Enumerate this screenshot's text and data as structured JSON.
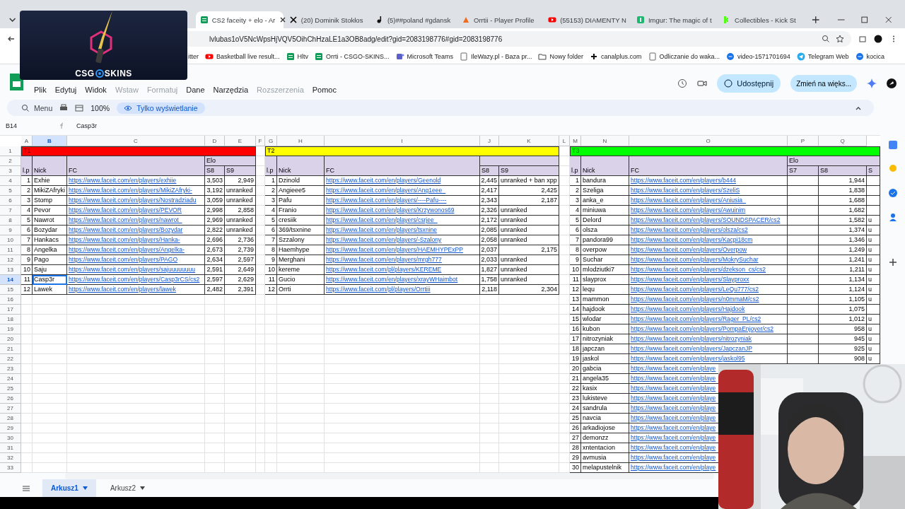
{
  "overlay": {
    "brand_left": "CSG",
    "brand_right": "SKINS"
  },
  "browser": {
    "tabs": [
      {
        "title": "CS2 faceity + elo - Ar",
        "kind": "sheets",
        "selected": true
      },
      {
        "title": "(20) Dominik Stokłos",
        "kind": "x",
        "selected": false
      },
      {
        "title": "(5)##poland #gdansk",
        "kind": "tiktok",
        "selected": false
      },
      {
        "title": "Orrtii - Player Profile",
        "kind": "orange",
        "selected": false
      },
      {
        "title": "(55153) DIAMENTY N",
        "kind": "youtube",
        "selected": false
      },
      {
        "title": "Imgur: The magic of t",
        "kind": "imgur",
        "selected": false
      },
      {
        "title": "Collectibles - Kick St",
        "kind": "kick",
        "selected": false
      }
    ],
    "url": "lvlubas1oV5NcWpsHjVQV5OihChHzaLE1a3OB8adg/edit?gid=2083198776#gid=2083198776",
    "bookmarks": [
      {
        "label": "itter",
        "kind": "none"
      },
      {
        "label": "Basketball live result...",
        "kind": "youtube"
      },
      {
        "label": "Hltv",
        "kind": "sheets"
      },
      {
        "label": "Orrti - CSGO-SKINS...",
        "kind": "sheets"
      },
      {
        "label": "Microsoft Teams",
        "kind": "teams"
      },
      {
        "label": "IleWazy.pl - Baza pr...",
        "kind": "page"
      },
      {
        "label": "Nowy folder",
        "kind": "folder"
      },
      {
        "label": "canalplus.com",
        "kind": "plus"
      },
      {
        "label": "Odliczanie do waka...",
        "kind": "page"
      },
      {
        "label": "video-1571701694",
        "kind": "link"
      },
      {
        "label": "Telegram Web",
        "kind": "telegram"
      },
      {
        "label": "kocica",
        "kind": "link"
      }
    ]
  },
  "sheets": {
    "menu": [
      {
        "label": "Plik",
        "disabled": false
      },
      {
        "label": "Edytuj",
        "disabled": false
      },
      {
        "label": "Widok",
        "disabled": false
      },
      {
        "label": "Wstaw",
        "disabled": true
      },
      {
        "label": "Formatuj",
        "disabled": true
      },
      {
        "label": "Dane",
        "disabled": false
      },
      {
        "label": "Narzędzia",
        "disabled": false
      },
      {
        "label": "Rozszerzenia",
        "disabled": true
      },
      {
        "label": "Pomoc",
        "disabled": false
      }
    ],
    "share_button": "Udostępnij",
    "upgrade_button": "Zmień na więks...",
    "search_placeholder": "Menu",
    "zoom": "100%",
    "view_mode": "Tylko wyświetlanie",
    "name_box": "B14",
    "formula": "Casp3r",
    "columns": [
      "A",
      "B",
      "C",
      "D",
      "E",
      "F",
      "G",
      "H",
      "I",
      "J",
      "K",
      "L",
      "M",
      "N",
      "O",
      "P",
      "Q"
    ],
    "row_numbers": [
      "1",
      "2",
      "3",
      "4",
      "5",
      "6",
      "7",
      "8",
      "9",
      "10",
      "11",
      "12",
      "13",
      "14",
      "15",
      "16",
      "17",
      "18",
      "19",
      "20",
      "21",
      "22",
      "23",
      "24",
      "25",
      "26",
      "27",
      "28",
      "29",
      "30",
      "31",
      "32",
      "33"
    ],
    "sheet_tabs": [
      {
        "label": "Arkusz1",
        "selected": true
      },
      {
        "label": "Arkusz2",
        "selected": false
      }
    ]
  },
  "tables": [
    {
      "title": "T1",
      "color": "#ff0000",
      "headers": {
        "lp": "l.p",
        "nick": "Nick",
        "fc": "FC"
      },
      "elo_label": "Elo",
      "elo_columns": [
        "S8",
        "S9"
      ],
      "rows": [
        {
          "lp": "1",
          "nick": "Exhie",
          "fc": "https://www.faceit.com/en/players/exhiie",
          "elo": [
            "3,503",
            "2,949"
          ],
          "selected": false
        },
        {
          "lp": "2",
          "nick": "MikiZAfryki",
          "fc": "https://www.faceit.com/en/players/MikiZAfryki-",
          "elo": [
            "3,192",
            "unranked"
          ],
          "selected": false
        },
        {
          "lp": "3",
          "nick": "Stomp",
          "fc": "https://www.faceit.com/en/players/Nostradziadu",
          "elo": [
            "3,059",
            "unranked"
          ],
          "selected": false
        },
        {
          "lp": "4",
          "nick": "Pevor",
          "fc": "https://www.faceit.com/en/players/PEVOR",
          "elo": [
            "2,998",
            "2,858"
          ],
          "selected": false
        },
        {
          "lp": "5",
          "nick": "Nawrot",
          "fc": "https://www.faceit.com/en/players/nawrot_",
          "elo": [
            "2,969",
            "unranked"
          ],
          "selected": false
        },
        {
          "lp": "6",
          "nick": "Bozydar",
          "fc": "https://www.faceit.com/en/players/Bozydar",
          "elo": [
            "2,822",
            "unranked"
          ],
          "selected": false
        },
        {
          "lp": "7",
          "nick": "Hankacs",
          "fc": "https://www.faceit.com/en/players/Hanka-",
          "elo": [
            "2,696",
            "2,736"
          ],
          "selected": false
        },
        {
          "lp": "8",
          "nick": "Angelka",
          "fc": "https://www.faceit.com/en/players/Angelka-",
          "elo": [
            "2,673",
            "2,739"
          ],
          "selected": false
        },
        {
          "lp": "9",
          "nick": "Pago",
          "fc": "https://www.faceit.com/en/players/PAGO",
          "elo": [
            "2,634",
            "2,597"
          ],
          "selected": false
        },
        {
          "lp": "10",
          "nick": "Saju",
          "fc": "https://www.faceit.com/en/players/sajuuuuuuuu",
          "elo": [
            "2,591",
            "2,649"
          ],
          "selected": false
        },
        {
          "lp": "11",
          "nick": "Casp3r",
          "fc": "https://www.faceit.com/en/players/Casp3rCS/cs2",
          "elo": [
            "2,597",
            "2,629"
          ],
          "selected": true
        },
        {
          "lp": "12",
          "nick": "Lawek",
          "fc": "https://www.faceit.com/en/players/lawek",
          "elo": [
            "2,482",
            "2,391"
          ],
          "selected": false
        }
      ]
    },
    {
      "title": "T2",
      "color": "#ffff00",
      "headers": {
        "lp": "l.p",
        "nick": "Nick",
        "fc": "FC"
      },
      "elo_columns": [
        "S8",
        "S9"
      ],
      "rows": [
        {
          "lp": "1",
          "nick": "Dzinold",
          "fc": "https://www.faceit.com/en/players/Geenold",
          "elo": [
            "2,445",
            "unranked + ban xpp"
          ],
          "selected": false
        },
        {
          "lp": "2",
          "nick": "Angieee5",
          "fc": "https://www.faceit.com/en/players/Ang1eee_",
          "elo": [
            "2,417",
            "2,425"
          ],
          "selected": false
        },
        {
          "lp": "3",
          "nick": "Pafu",
          "fc": "https://www.faceit.com/en/players/----Pafu----",
          "elo": [
            "2,343",
            "2,187"
          ],
          "selected": false
        },
        {
          "lp": "4",
          "nick": "Franio",
          "fc": "https://www.faceit.com/en/players/Krzywonos69",
          "elo": [
            "2,326",
            "unranked"
          ],
          "selected": false
        },
        {
          "lp": "5",
          "nick": "cresiik",
          "fc": "https://www.faceit.com/en/players/csrjee_",
          "elo": [
            "2,172",
            "unranked"
          ],
          "selected": false
        },
        {
          "lp": "6",
          "nick": "369/tsxnine",
          "fc": "https://www.faceit.com/en/players/tsxnine",
          "elo": [
            "2,085",
            "unranked"
          ],
          "selected": false
        },
        {
          "lp": "7",
          "nick": "Szzalony",
          "fc": "https://www.faceit.com/en/players/-Szalony",
          "elo": [
            "2,058",
            "unranked"
          ],
          "selected": false
        },
        {
          "lp": "8",
          "nick": "Haemhype",
          "fc": "https://www.faceit.com/en/players/HAEMHYPExPP",
          "elo": [
            "2,037",
            "2,175"
          ],
          "selected": false
        },
        {
          "lp": "9",
          "nick": "Merghani",
          "fc": "https://www.faceit.com/en/players/mrgh777",
          "elo": [
            "2,033",
            "unranked"
          ],
          "selected": false
        },
        {
          "lp": "10",
          "nick": "kereme",
          "fc": "https://www.faceit.com/pl/players/KEREME",
          "elo": [
            "1,827",
            "unranked"
          ],
          "selected": false
        },
        {
          "lp": "11",
          "nick": "Gucio",
          "fc": "https://www.faceit.com/en/players/xrayWHaimbot",
          "elo": [
            "1,758",
            "unranked"
          ],
          "selected": false
        },
        {
          "lp": "12",
          "nick": "Orrti",
          "fc": "https://www.faceit.com/pl/players/Orrtiii",
          "elo": [
            "2,118",
            "2,304"
          ],
          "selected": false
        }
      ]
    },
    {
      "title": "T3",
      "color": "#00ff00",
      "headers": {
        "lp": "l.p",
        "nick": "Nick",
        "fc": "FC"
      },
      "elo_label": "Elo",
      "empty_columns": [
        "S7"
      ],
      "elo_columns": [
        "S8",
        "S"
      ],
      "rows": [
        {
          "lp": "1",
          "nick": "bandura",
          "fc": "https://www.faceit.com/en/players/b444",
          "elo": [
            "1,944"
          ],
          "selected": false
        },
        {
          "lp": "2",
          "nick": "Szeliga",
          "fc": "https://www.faceit.com/en/players/SzeliS",
          "elo": [
            "1,838"
          ],
          "selected": false
        },
        {
          "lp": "3",
          "nick": "anka_e",
          "fc": "https://www.faceit.com/en/players/Aniusia_",
          "elo": [
            "1,688"
          ],
          "selected": false
        },
        {
          "lp": "4",
          "nick": "miniuwa",
          "fc": "https://www.faceit.com/en/players/Awuinim",
          "elo": [
            "1,682"
          ],
          "selected": false
        },
        {
          "lp": "5",
          "nick": "Delord",
          "fc": "https://www.faceit.com/en/players/SOUNDSPACER/cs2",
          "elo": [
            "1,582",
            "u"
          ],
          "selected": false
        },
        {
          "lp": "6",
          "nick": "olsza",
          "fc": "https://www.faceit.com/en/players/olsza/cs2",
          "elo": [
            "1,374",
            "u"
          ],
          "selected": false
        },
        {
          "lp": "7",
          "nick": "pandora99",
          "fc": "https://www.faceit.com/en/players/Kacpi18cm",
          "elo": [
            "1,346",
            "u"
          ],
          "selected": false
        },
        {
          "lp": "8",
          "nick": "overpow",
          "fc": "https://www.faceit.com/en/players/Overpow",
          "elo": [
            "1,249",
            "u"
          ],
          "selected": false
        },
        {
          "lp": "9",
          "nick": "Suchar",
          "fc": "https://www.faceit.com/en/players/MokrySuchar",
          "elo": [
            "1,241",
            "u"
          ],
          "selected": false
        },
        {
          "lp": "10",
          "nick": "mlodziutki7",
          "fc": "https://www.faceit.com/en/players/dzekson_cs/cs2",
          "elo": [
            "1,211",
            "u"
          ],
          "selected": false
        },
        {
          "lp": "11",
          "nick": "slayprox",
          "fc": "https://www.faceit.com/en/players/Slayproxx",
          "elo": [
            "1,134",
            "u"
          ],
          "selected": false
        },
        {
          "lp": "12",
          "nick": "lequ",
          "fc": "https://www.faceit.com/en/players/LeQu777/cs2",
          "elo": [
            "1,124",
            "u"
          ],
          "selected": false
        },
        {
          "lp": "13",
          "nick": "mammon",
          "fc": "https://www.faceit.com/en/players/n0mmaM/cs2",
          "elo": [
            "1,105",
            "u"
          ],
          "selected": false
        },
        {
          "lp": "14",
          "nick": "hajdook",
          "fc": "https://www.faceit.com/en/players/Hajdook",
          "elo": [
            "1,075"
          ],
          "selected": false
        },
        {
          "lp": "15",
          "nick": "wlodar",
          "fc": "https://www.faceit.com/en/players/Rager_PL/cs2",
          "elo": [
            "1,012",
            "u"
          ],
          "selected": false
        },
        {
          "lp": "16",
          "nick": "kubon",
          "fc": "https://www.faceit.com/en/players/PompaEnjoyer/cs2",
          "elo": [
            "958",
            "u"
          ],
          "selected": false
        },
        {
          "lp": "17",
          "nick": "nitrozyniak",
          "fc": "https://www.faceit.com/en/players/nitrozyniak",
          "elo": [
            "945",
            "u"
          ],
          "selected": false
        },
        {
          "lp": "18",
          "nick": "japczan",
          "fc": "https://www.faceit.com/en/players/JapczanJP",
          "elo": [
            "925",
            "u"
          ],
          "selected": false
        },
        {
          "lp": "19",
          "nick": "jaskol",
          "fc": "https://www.faceit.com/en/players/jaskol95",
          "elo": [
            "908",
            "u"
          ],
          "selected": false
        },
        {
          "lp": "20",
          "nick": "gabcia",
          "fc": "https://www.faceit.com/en/playe",
          "selected": false
        },
        {
          "lp": "21",
          "nick": "angela35",
          "fc": "https://www.faceit.com/en/playe",
          "selected": false
        },
        {
          "lp": "22",
          "nick": "kasix",
          "fc": "https://www.faceit.com/en/playe",
          "selected": false
        },
        {
          "lp": "23",
          "nick": "lukisteve",
          "fc": "https://www.faceit.com/en/playe",
          "selected": false
        },
        {
          "lp": "24",
          "nick": "sandrula",
          "fc": "https://www.faceit.com/en/playe",
          "selected": false
        },
        {
          "lp": "25",
          "nick": "navcia",
          "fc": "https://www.faceit.com/en/playe",
          "selected": false
        },
        {
          "lp": "26",
          "nick": "arkadiojose",
          "fc": "https://www.faceit.com/en/playe",
          "selected": false
        },
        {
          "lp": "27",
          "nick": "demonzz",
          "fc": "https://www.faceit.com/en/playe",
          "selected": false
        },
        {
          "lp": "28",
          "nick": "xntentacion",
          "fc": "https://www.faceit.com/en/playe",
          "selected": false
        },
        {
          "lp": "29",
          "nick": "avmusia",
          "fc": "https://www.faceit.com/en/playe",
          "selected": false
        },
        {
          "lp": "30",
          "nick": "melapustelnik",
          "fc": "https://www.faceit.com/en/playe",
          "selected": false
        }
      ]
    }
  ]
}
